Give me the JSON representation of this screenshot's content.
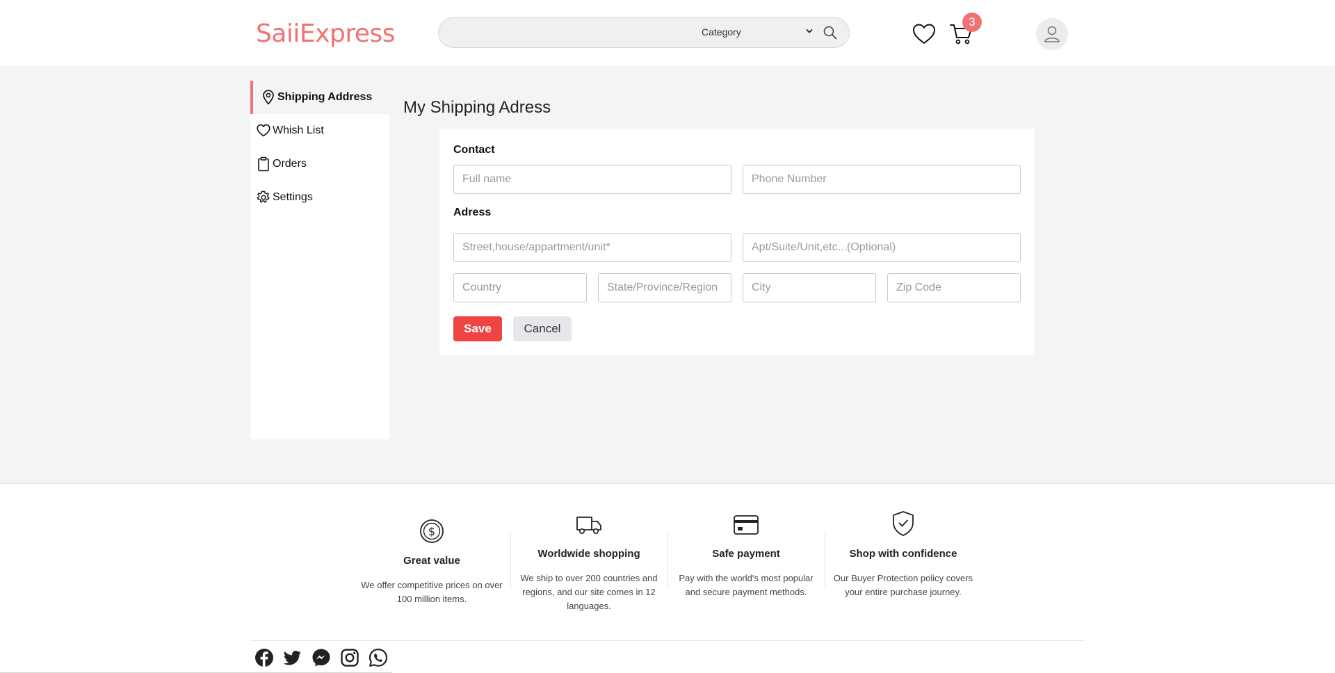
{
  "header": {
    "logo": "SaiiExpress",
    "search_placeholder": "",
    "category_label": "Category",
    "cart_count": "3"
  },
  "sidebar": {
    "items": [
      {
        "label": "Shipping Address",
        "icon": "map-pin-icon",
        "active": true
      },
      {
        "label": "Whish List",
        "icon": "heart-icon"
      },
      {
        "label": "Orders",
        "icon": "clipboard-icon"
      },
      {
        "label": "Settings",
        "icon": "gear-icon"
      }
    ]
  },
  "page": {
    "title": "My Shipping Adress"
  },
  "form": {
    "contact_label": "Contact",
    "address_label": "Adress",
    "full_name_placeholder": "Full name",
    "phone_placeholder": "Phone Number",
    "street_placeholder": "Street,house/appartment/unit*",
    "apt_placeholder": "Apt/Suite/Unit,etc...(Optional)",
    "country_placeholder": "Country",
    "state_placeholder": "State/Province/Region",
    "city_placeholder": "City",
    "zip_placeholder": "Zip Code",
    "save_label": "Save",
    "cancel_label": "Cancel"
  },
  "footer": {
    "features": [
      {
        "icon": "dollar-coin-icon",
        "title": "Great value",
        "desc": "We offer competitive prices on over 100 million items."
      },
      {
        "icon": "truck-icon",
        "title": "Worldwide shopping",
        "desc": "We ship to over 200 countries and regions, and our site comes in 12 languages."
      },
      {
        "icon": "credit-card-icon",
        "title": "Safe payment",
        "desc": "Pay with the world's most popular and secure payment methods."
      },
      {
        "icon": "shield-check-icon",
        "title": "Shop with confidence",
        "desc": "Our Buyer Protection policy covers your entire purchase journey."
      }
    ],
    "social": [
      "facebook-icon",
      "twitter-icon",
      "messenger-icon",
      "instagram-icon",
      "whatsapp-icon"
    ]
  },
  "colors": {
    "brand": "#f07272",
    "save_button": "#ef4444",
    "page_background": "#f3f4f6"
  }
}
